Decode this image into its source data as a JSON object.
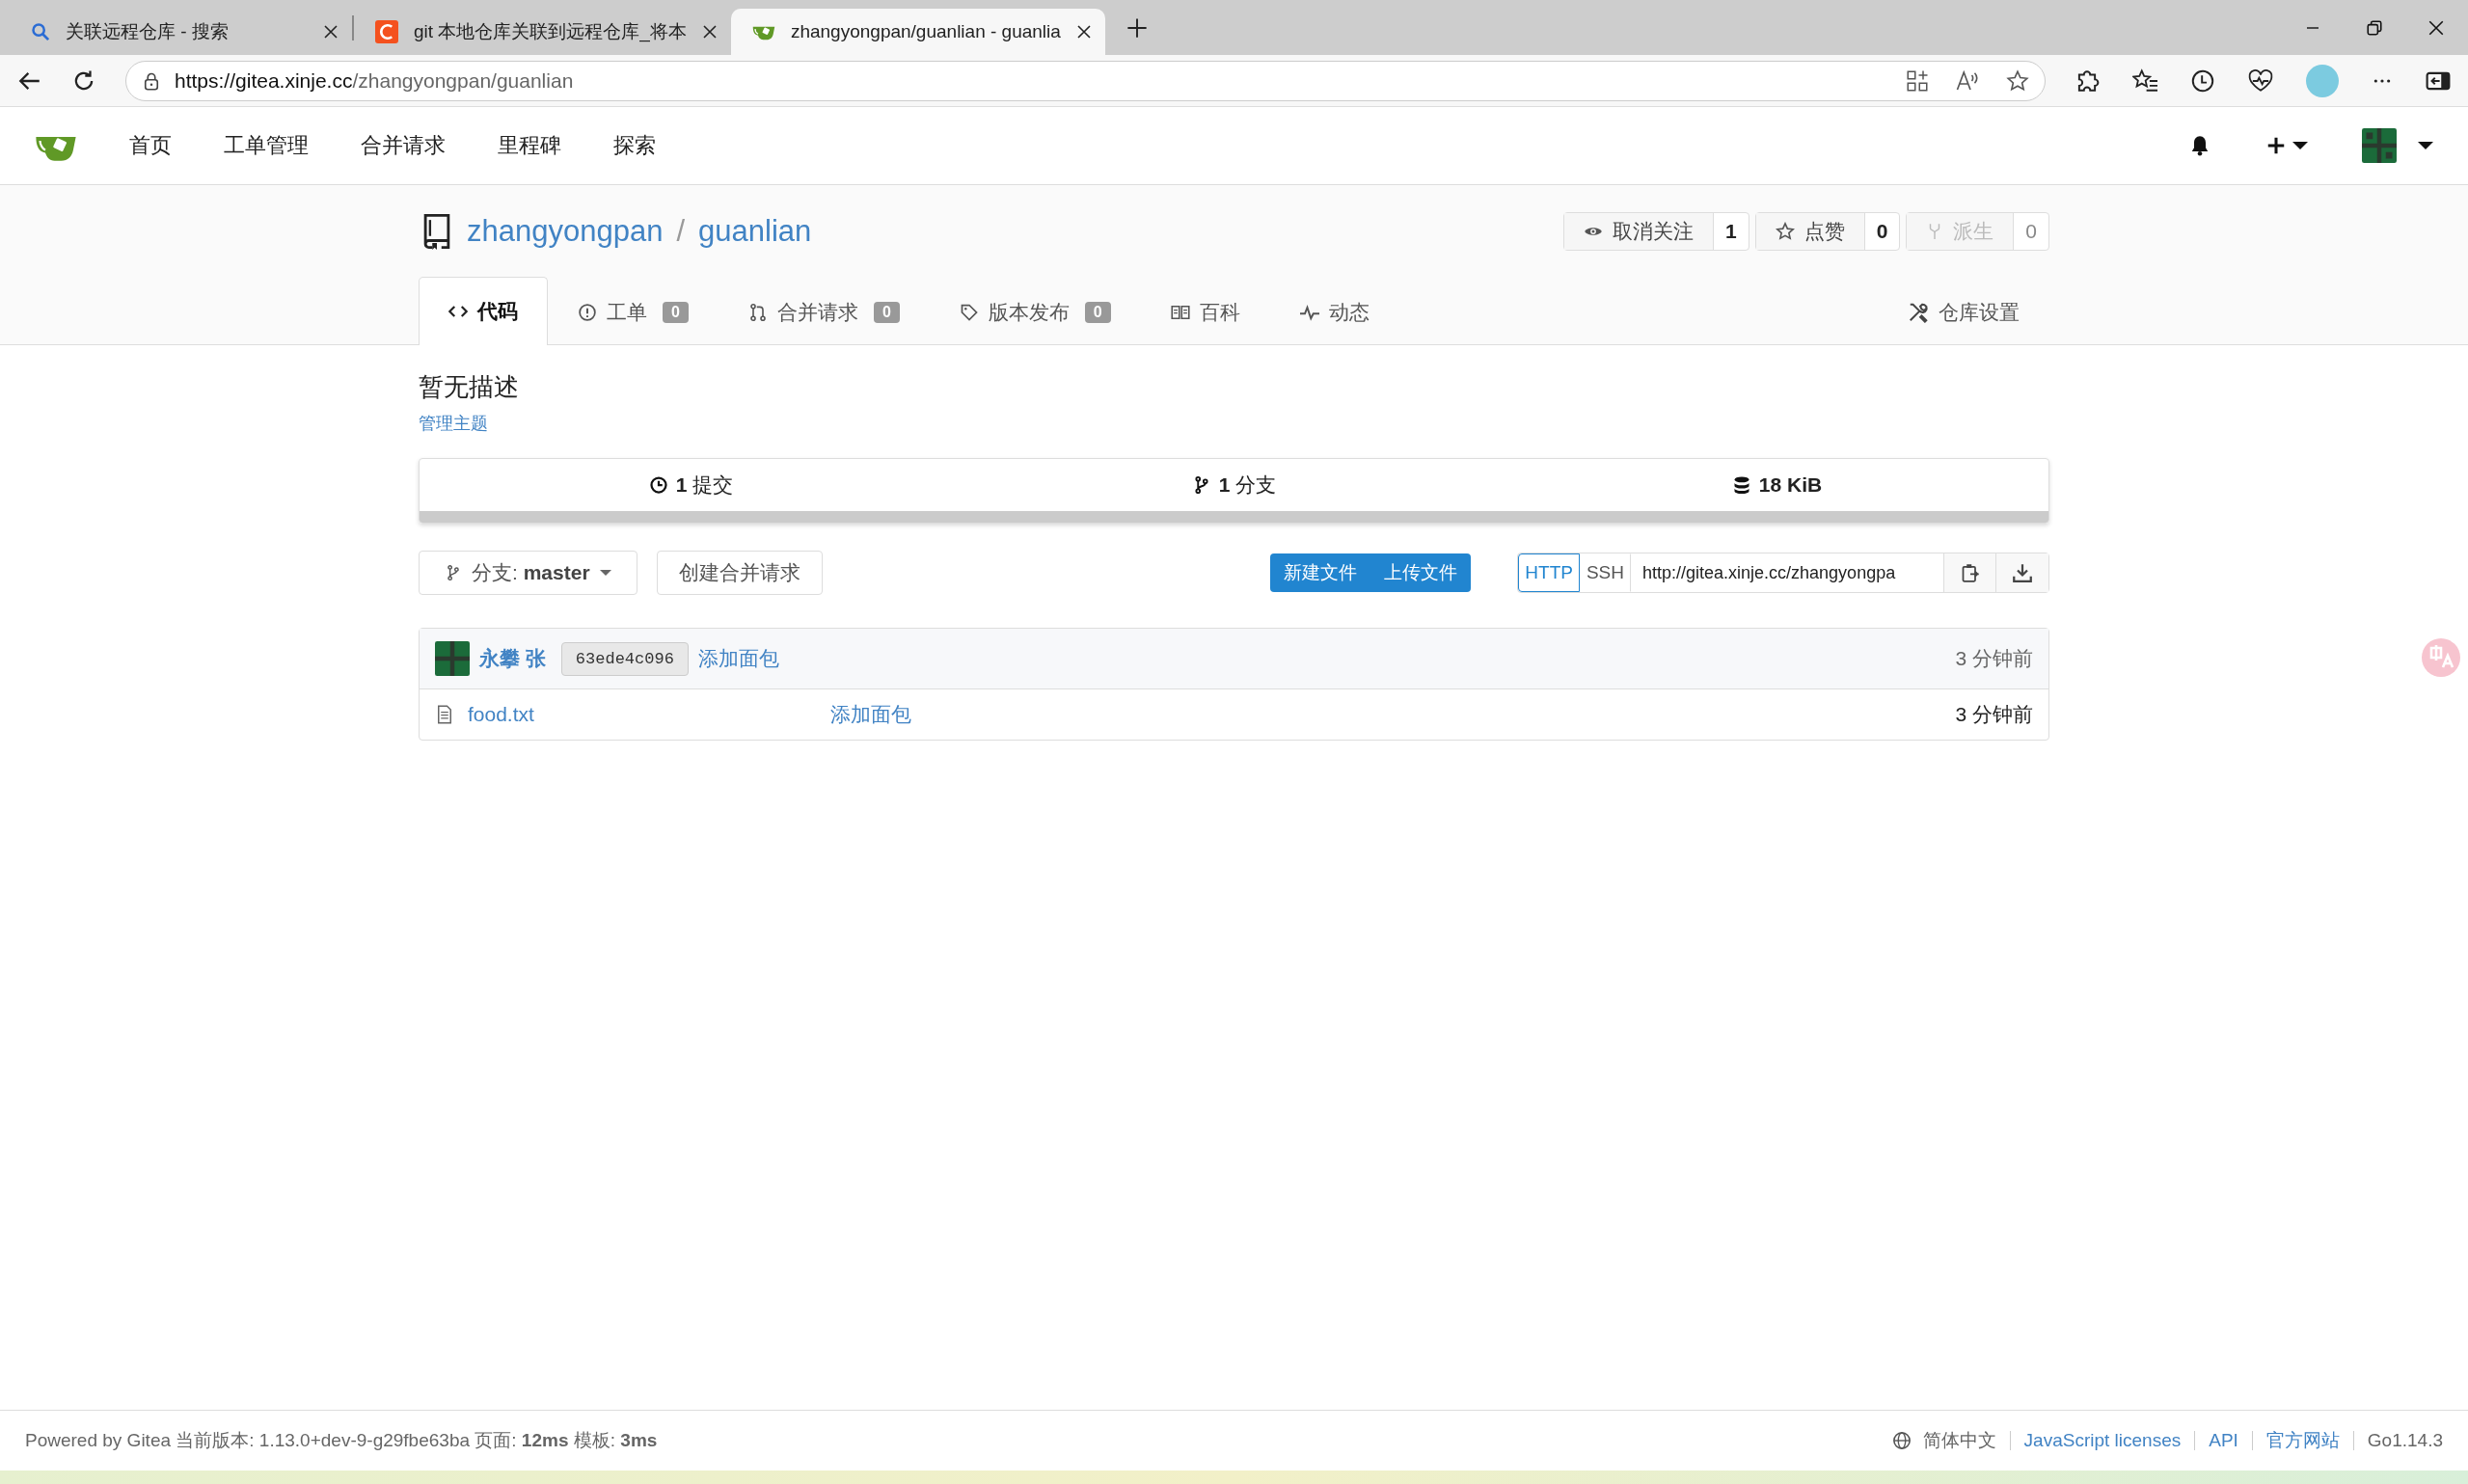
{
  "browser": {
    "tabs": [
      {
        "kind": "search",
        "title": "关联远程仓库 - 搜索",
        "selected": false
      },
      {
        "kind": "csdn",
        "title": "git 本地仓库关联到远程仓库_将本",
        "selected": false
      },
      {
        "kind": "gitea",
        "title": "zhangyongpan/guanlian - guanlia",
        "selected": true
      }
    ],
    "address": {
      "host": "https://gitea.xinje.cc",
      "path": "/zhangyongpan/guanlian"
    }
  },
  "nav": {
    "items": [
      "首页",
      "工单管理",
      "合并请求",
      "里程碑",
      "探索"
    ]
  },
  "repo": {
    "owner": "zhangyongpan",
    "separator": "/",
    "name": "guanlian",
    "actions": [
      {
        "kind": "watch",
        "label": "取消关注",
        "count": "1",
        "disabled": false
      },
      {
        "kind": "star",
        "label": "点赞",
        "count": "0",
        "disabled": false
      },
      {
        "kind": "fork",
        "label": "派生",
        "count": "0",
        "disabled": true
      }
    ],
    "tabs": [
      {
        "kind": "code",
        "label": "代码",
        "selected": true
      },
      {
        "kind": "issues",
        "label": "工单",
        "count": "0",
        "selected": false
      },
      {
        "kind": "pulls",
        "label": "合并请求",
        "count": "0",
        "selected": false
      },
      {
        "kind": "releases",
        "label": "版本发布",
        "count": "0",
        "selected": false
      },
      {
        "kind": "wiki",
        "label": "百科",
        "selected": false
      },
      {
        "kind": "activity",
        "label": "动态",
        "selected": false
      }
    ],
    "settings": "仓库设置"
  },
  "description": "暂无描述",
  "topics_link": "管理主题",
  "stats": [
    {
      "kind": "commits",
      "number": "1",
      "label": "提交"
    },
    {
      "kind": "branches",
      "number": "1",
      "label": "分支"
    },
    {
      "kind": "size",
      "number": "18 KiB"
    }
  ],
  "toolbar": {
    "branch_label": "分支:",
    "branch": "master",
    "new_pr": "创建合并请求",
    "new_file": "新建文件",
    "upload_file": "上传文件",
    "clone": {
      "protocols": [
        {
          "label": "HTTP",
          "selected": true
        },
        {
          "label": "SSH",
          "selected": false
        }
      ],
      "url": "http://gitea.xinje.cc/zhangyongpa"
    }
  },
  "latest_commit": {
    "author": "永攀 张",
    "sha": "63ede4c096",
    "message": "添加面包",
    "time": "3 分钟前"
  },
  "files": [
    {
      "name": "food.txt",
      "message": "添加面包",
      "time": "3 分钟前"
    }
  ],
  "footer": {
    "text": "Powered by Gitea 当前版本: 1.13.0+dev-9-g29fbe63ba 页面: **12ms** 模板: **3ms**",
    "language": "简体中文",
    "links": [
      "JavaScript licenses",
      "API",
      "官方网站"
    ],
    "go_version": "Go1.14.3"
  }
}
